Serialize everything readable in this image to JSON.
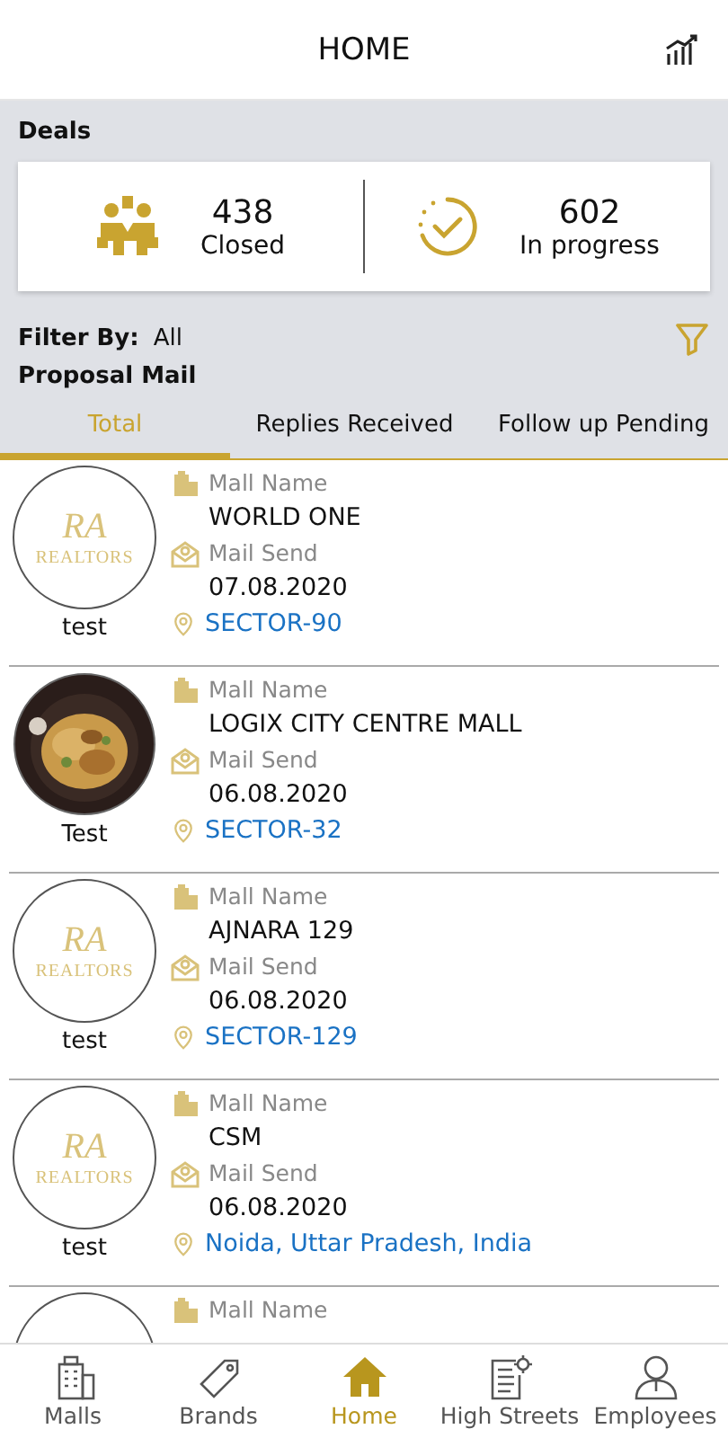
{
  "header": {
    "title": "HOME"
  },
  "deals": {
    "title": "Deals",
    "stats": [
      {
        "kind": "closed",
        "value": "438",
        "label": "Closed"
      },
      {
        "kind": "progress",
        "value": "602",
        "label": "In progress"
      }
    ]
  },
  "filter": {
    "label": "Filter By:",
    "value": "All"
  },
  "section_title": "Proposal Mail",
  "tabs": [
    {
      "label": "Total",
      "selected": true
    },
    {
      "label": "Replies Received",
      "selected": false
    },
    {
      "label": "Follow up Pending",
      "selected": false
    }
  ],
  "items": [
    {
      "avatar": {
        "kind": "logo",
        "monogram": "RA",
        "text": "REALTORS"
      },
      "caption": "test",
      "mall_label": "Mall Name",
      "mall": "WORLD ONE",
      "send_label": "Mail Send",
      "date": "07.08.2020",
      "location": "SECTOR-90"
    },
    {
      "caption": "Test",
      "mall_label": "Mall Name",
      "mall": "LOGIX CITY CENTRE MALL",
      "send_label": "Mail Send",
      "date": "06.08.2020",
      "location": "SECTOR-32"
    },
    {
      "avatar": {
        "kind": "logo",
        "monogram": "RA",
        "text": "REALTORS"
      },
      "caption": "test",
      "mall_label": "Mall Name",
      "mall": "AJNARA 129",
      "send_label": "Mail Send",
      "date": "06.08.2020",
      "location": "SECTOR-129"
    },
    {
      "avatar": {
        "kind": "logo",
        "monogram": "RA",
        "text": "REALTORS"
      },
      "caption": "test",
      "mall_label": "Mall Name",
      "mall": "CSM",
      "send_label": "Mail Send",
      "date": "06.08.2020",
      "location": "Noida, Uttar Pradesh, India"
    },
    {
      "avatar": {
        "kind": "empty"
      },
      "mall_label": "Mall Name"
    }
  ],
  "nav": [
    {
      "kind": "malls",
      "label": "Malls",
      "selected": false
    },
    {
      "kind": "brands",
      "label": "Brands",
      "selected": false
    },
    {
      "kind": "home",
      "label": "Home",
      "selected": true
    },
    {
      "kind": "streets",
      "label": "High Streets",
      "selected": false
    },
    {
      "kind": "employees",
      "label": "Employees",
      "selected": false
    }
  ]
}
